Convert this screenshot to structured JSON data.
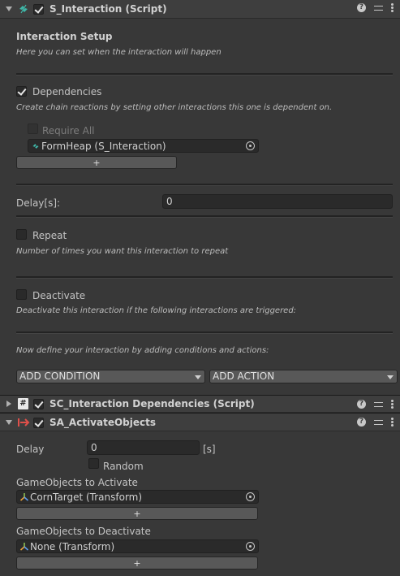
{
  "components": {
    "s_interaction": {
      "title": "S_Interaction (Script)",
      "enabled": true,
      "section_title": "Interaction Setup",
      "section_desc": "Here you can set when the interaction will happen",
      "dependencies": {
        "label": "Dependencies",
        "checked": true,
        "desc": "Create chain reactions by setting other interactions this one is dependent on.",
        "require_all_label": "Require All",
        "item_value": "FormHeap (S_Interaction)",
        "add_button": "+"
      },
      "delay": {
        "label": "Delay[s]:",
        "value": "0"
      },
      "repeat": {
        "label": "Repeat",
        "checked": false,
        "desc": "Number of times you want this interaction to repeat"
      },
      "deactivate": {
        "label": "Deactivate",
        "checked": false,
        "desc": "Deactivate this interaction if the following interactions are triggered:"
      },
      "define_desc": "Now define your interaction by adding conditions and actions:",
      "add_condition": "ADD CONDITION",
      "add_action": "ADD ACTION"
    },
    "sc_dependencies": {
      "title": "SC_Interaction Dependencies (Script)",
      "enabled": true
    },
    "sa_activate": {
      "title": "SA_ActivateObjects",
      "enabled": true,
      "delay_label": "Delay",
      "delay_value": "0",
      "delay_unit": "[s]",
      "random_label": "Random",
      "activate_label": "GameObjects to Activate",
      "activate_value": "CornTarget (Transform)",
      "deactivate_label": "GameObjects to Deactivate",
      "deactivate_value": "None (Transform)",
      "add_button": "+"
    }
  },
  "icons": {
    "help": "?",
    "script": "#"
  },
  "colors": {
    "background": "#383838",
    "header": "#3e3e3e",
    "field": "#2a2a2a",
    "button": "#585858",
    "accent_teal": "#3fb7a8",
    "accent_red": "#e0504a"
  }
}
